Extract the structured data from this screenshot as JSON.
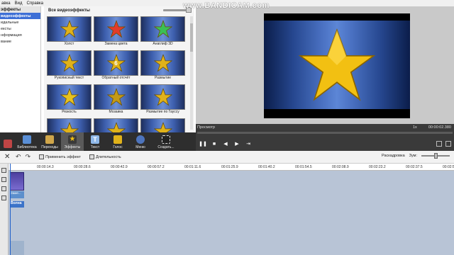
{
  "menubar": [
    "авка",
    "Вид",
    "Справка"
  ],
  "watermark": "www.BANDICAM.com",
  "categories": {
    "header": "эффекты",
    "items": [
      "видеоэффекты",
      "идальные",
      "ексты",
      "нформация",
      "вание"
    ],
    "selected_index": 0
  },
  "gallery": {
    "title": "Все видеоэффекты",
    "tiles": [
      {
        "label": "Холст",
        "star": "#e0b21a",
        "overlay": ""
      },
      {
        "label": "Замена цвета",
        "star": "#e23b2a",
        "overlay": ""
      },
      {
        "label": "Анаглиф 3D",
        "star": "#3bbf55",
        "overlay": ""
      },
      {
        "label": "Рукописный текст",
        "star": "#e0b21a",
        "overlay": ""
      },
      {
        "label": "Обратный отсчёт",
        "star": "#e0b21a",
        "overlay": "6"
      },
      {
        "label": "Размытие",
        "star": "#e0b21a",
        "overlay": ""
      },
      {
        "label": "Резкость",
        "star": "#e8c21f",
        "overlay": ""
      },
      {
        "label": "Мозаика",
        "star": "#c49a16",
        "overlay": ""
      },
      {
        "label": "Размытие по Гауссу",
        "star": "#e0b21a",
        "overlay": ""
      },
      {
        "label": "",
        "star": "#e0b21a",
        "overlay": ""
      },
      {
        "label": "",
        "star": "#e0b21a",
        "overlay": ""
      },
      {
        "label": "",
        "star": "#e0b21a",
        "overlay": ""
      }
    ]
  },
  "player": {
    "label": "Просмотр",
    "speed": "1x",
    "time": "00:00:02.380"
  },
  "toolbar": {
    "items": [
      "Библиотека",
      "Переходы",
      "Эффекты",
      "Текст",
      "Голос",
      "Меню",
      "Создать..."
    ],
    "active": "Эффекты"
  },
  "timeline_toolbar": {
    "apply_effect": "Применить эффект",
    "duration": "Длительность",
    "storyboard": "Раскадровка",
    "zoom": "Зум:"
  },
  "ruler": [
    "00:00:14.3",
    "00:00:28.6",
    "00:00:42.9",
    "00:00:57.2",
    "00:01:11.6",
    "00:01:25.9",
    "00:01:40.2",
    "00:01:54.5",
    "00:02:08.9",
    "00:02:23.2",
    "00:02:37.5",
    "00:02:5"
  ],
  "clips": {
    "audio": "Заме...",
    "fx": "Волна"
  }
}
